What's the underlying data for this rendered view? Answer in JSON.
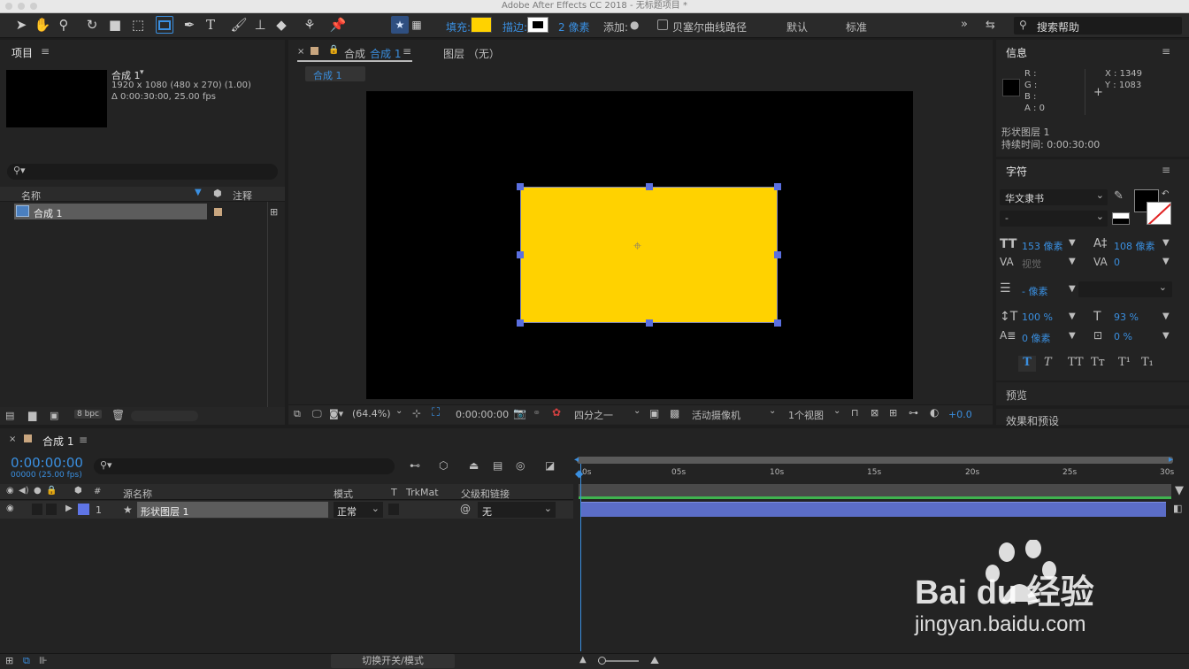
{
  "window": {
    "title": "Adobe After Effects CC 2018 - 无标题项目 *"
  },
  "toolbar": {
    "fill_label": "填充:",
    "stroke_label": "描边:",
    "stroke_width": "2 像素",
    "add_label": "添加:",
    "bezier_label": "贝塞尔曲线路径",
    "workspace_default": "默认",
    "workspace_standard": "标准",
    "search_placeholder": "搜索帮助",
    "fill_color": "#ffd200",
    "stroke_color": "#ffffff"
  },
  "project": {
    "title": "项目",
    "comp_name": "合成 1",
    "comp_dims": "1920 x 1080  (480 x 270) (1.00)",
    "comp_duration": "Δ 0:00:30:00, 25.00 fps",
    "col_name": "名称",
    "col_comment": "注释",
    "item_name": "合成 1",
    "bpc": "8 bpc"
  },
  "comp_viewer": {
    "tab_prefix": "合成",
    "tab_name": "合成 1",
    "layer_tab": "图层 （无）",
    "breadcrumb": "合成 1",
    "zoom": "(64.4%)",
    "timecode": "0:00:00:00",
    "resolution": "四分之一",
    "camera": "活动摄像机",
    "views": "1个视图",
    "exposure": "+0.0",
    "shape_color": "#ffd200"
  },
  "info": {
    "title": "信息",
    "r_label": "R :",
    "g_label": "G :",
    "b_label": "B :",
    "a_label": "A :  0",
    "x_label": "X : 1349",
    "y_label": "Y : 1083",
    "layer_name": "形状图层 1",
    "duration": "持续时间: 0:00:30:00"
  },
  "character": {
    "title": "字符",
    "font": "华文隶书",
    "style": "-",
    "size": "153 像素",
    "leading": "108 像素",
    "kerning": "视觉",
    "tracking": "0",
    "stroke_width": "- 像素",
    "v_scale": "100 %",
    "h_scale": "93 %",
    "baseline": "0 像素",
    "tsume": "0 %"
  },
  "preview": {
    "title": "预览"
  },
  "effects": {
    "title": "效果和预设"
  },
  "timeline": {
    "tab_name": "合成 1",
    "timecode": "0:00:00:00",
    "frame_info": "00000 (25.00 fps)",
    "col_source": "源名称",
    "col_mode": "模式",
    "col_t": "T",
    "col_trkmat": "TrkMat",
    "col_parent": "父级和链接",
    "layer_num": "1",
    "layer_name": "形状图层 1",
    "layer_mode": "正常",
    "layer_parent": "无",
    "ticks": [
      "0s",
      "05s",
      "10s",
      "15s",
      "20s",
      "25s",
      "30s"
    ],
    "toggle_label": "切换开关/模式"
  },
  "watermark": {
    "brand": "Bai du 经验",
    "url": "jingyan.baidu.com"
  }
}
